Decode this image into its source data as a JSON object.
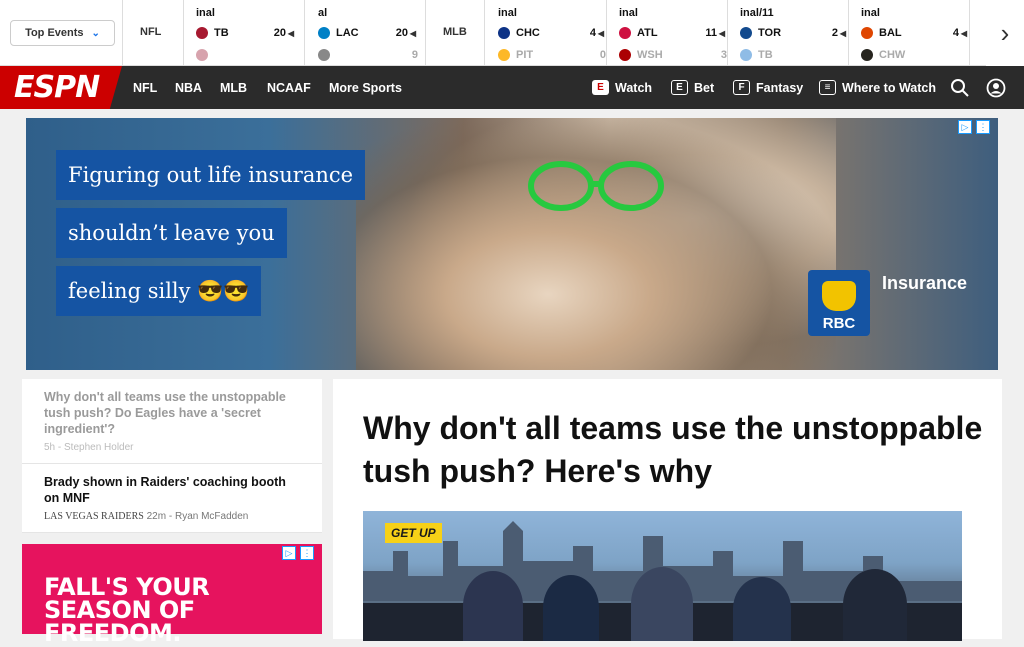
{
  "scorestrip": {
    "top_events_label": "Top Events",
    "leagues": {
      "nfl": "NFL",
      "mlb": "MLB"
    },
    "games": [
      {
        "status": "inal",
        "teams": [
          {
            "abbr": "TB",
            "score": "20",
            "color": "#a71930"
          },
          {
            "abbr": "",
            "score": "",
            "color": "#a71930"
          }
        ]
      },
      {
        "status": "al",
        "teams": [
          {
            "abbr": "LAC",
            "score": "20",
            "color": "#0080c6"
          },
          {
            "abbr": "",
            "score": "9",
            "color": "#888888"
          }
        ]
      },
      {
        "status": "inal",
        "teams": [
          {
            "abbr": "CHC",
            "score": "4",
            "color": "#0e3386"
          },
          {
            "abbr": "PIT",
            "score": "0",
            "color": "#fdb827"
          }
        ]
      },
      {
        "status": "inal",
        "teams": [
          {
            "abbr": "ATL",
            "score": "11",
            "color": "#ce1141"
          },
          {
            "abbr": "WSH",
            "score": "3",
            "color": "#ab0003"
          }
        ]
      },
      {
        "status": "inal/11",
        "teams": [
          {
            "abbr": "TOR",
            "score": "2",
            "color": "#134a8e"
          },
          {
            "abbr": "TB",
            "score": "",
            "color": "#8fbce6"
          }
        ]
      },
      {
        "status": "inal",
        "teams": [
          {
            "abbr": "BAL",
            "score": "4",
            "color": "#df4601"
          },
          {
            "abbr": "CHW",
            "score": "",
            "color": "#27251f"
          }
        ]
      }
    ]
  },
  "nav": {
    "logo": "ESPN",
    "links": [
      "NFL",
      "NBA",
      "MLB",
      "NCAAF",
      "More Sports"
    ],
    "watch": "Watch",
    "bet": "Bet",
    "fantasy": "Fantasy",
    "where_to_watch": "Where to Watch"
  },
  "ad": {
    "lines": [
      "Figuring out life insurance",
      "shouldn’t leave you",
      "feeling silly 😎😎"
    ],
    "brand": "RBC",
    "brand_tagline": "Insurance"
  },
  "sidebar": {
    "stories": [
      {
        "title": "Why don't all teams use the unstoppable tush push? Do Eagles have a 'secret ingredient'?",
        "time": "5h",
        "author": "Stephen Holder"
      },
      {
        "title": "Brady shown in Raiders' coaching booth on MNF",
        "source": "Las Vegas Raiders",
        "time": "22m",
        "author": "Ryan McFadden"
      }
    ],
    "ad_text": "FALL'S YOUR SEASON OF FREEDOM."
  },
  "article": {
    "headline": "Why don't all teams use the unstoppable tush push? Here's why",
    "video_badge": "GET UP"
  }
}
